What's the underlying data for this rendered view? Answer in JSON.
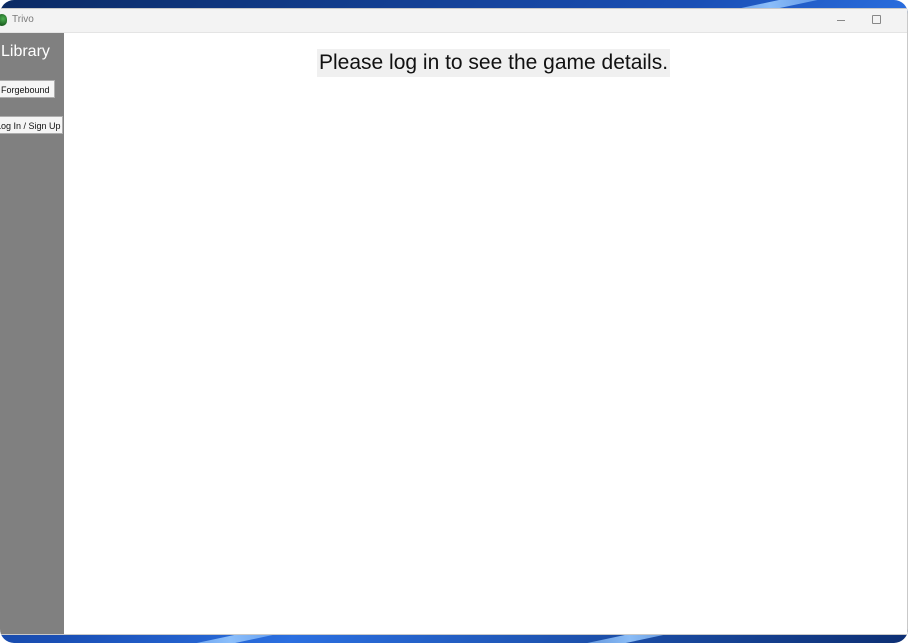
{
  "window": {
    "title": "Trivo",
    "controls": {
      "minimize_icon": "minimize-icon",
      "maximize_icon": "maximize-icon"
    }
  },
  "sidebar": {
    "title": "Library",
    "items": [
      {
        "label": "Forgebound"
      },
      {
        "label": "Log In / Sign Up"
      }
    ],
    "background": "#808080"
  },
  "main": {
    "message": "Please log in to see the game details."
  },
  "colors": {
    "titlebar": "#f3f3f3",
    "sidebar": "#808080",
    "message_bg": "#f0f0f0"
  }
}
